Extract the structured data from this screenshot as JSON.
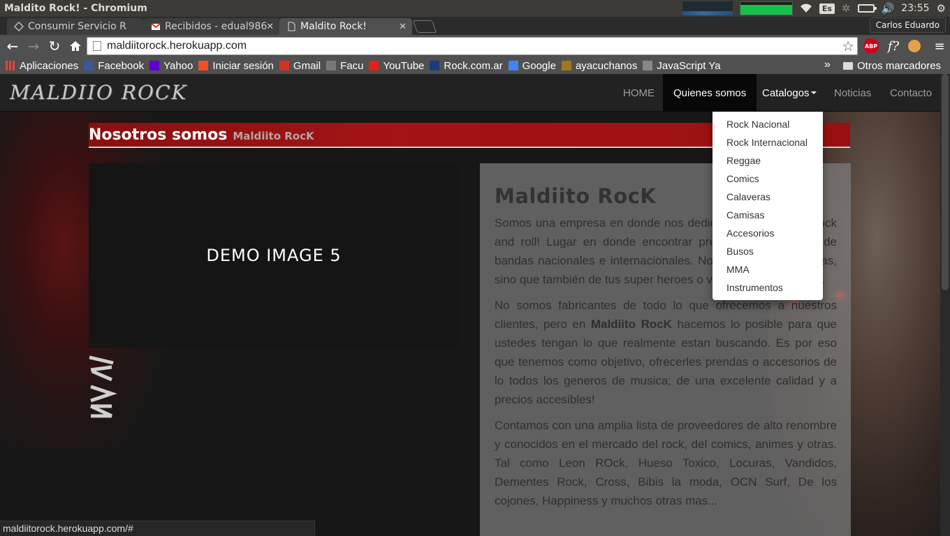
{
  "os": {
    "window_title": "Maldito Rock! - Chromium",
    "lang": "Es",
    "clock": "23:55"
  },
  "tabs": [
    {
      "label": "Consumir Servicio R",
      "icon": "servicio-icon"
    },
    {
      "label": "Recibidos - edual986",
      "icon": "gmail-icon"
    },
    {
      "label": "Maldito Rock!",
      "icon": "page-icon"
    }
  ],
  "profile_name": "Carlos Eduardo",
  "omnibox": {
    "url": "maldiitorock.herokuapp.com"
  },
  "bookmarks": {
    "items": [
      {
        "label": "Aplicaciones",
        "icon": "apps-grid-icon",
        "color": "#e8453c"
      },
      {
        "label": "Facebook",
        "icon": "facebook-icon",
        "color": "#3b5998"
      },
      {
        "label": "Yahoo",
        "icon": "yahoo-icon",
        "color": "#5f01d1"
      },
      {
        "label": "Iniciar sesión",
        "icon": "microsoft-icon",
        "color": "#f25022"
      },
      {
        "label": "Gmail",
        "icon": "gmail-icon",
        "color": "#d93025"
      },
      {
        "label": "Facu",
        "icon": "facu-icon",
        "color": "#777777"
      },
      {
        "label": "YouTube",
        "icon": "youtube-icon",
        "color": "#e62117"
      },
      {
        "label": "Rock.com.ar",
        "icon": "rock-icon",
        "color": "#1b3c7a"
      },
      {
        "label": "Google",
        "icon": "google-icon",
        "color": "#4285f4"
      },
      {
        "label": "ayacuchanos",
        "icon": "ayacuchanos-icon",
        "color": "#a07820"
      },
      {
        "label": "JavaScript Ya",
        "icon": "page-icon",
        "color": "#888888"
      }
    ],
    "more": "»",
    "other": "Otros marcadores"
  },
  "site": {
    "brand": "MALDIIO ROCK",
    "nav": {
      "home": "HOME",
      "quienes": "Quienes somos",
      "catalogos": "Catalogos",
      "noticias": "Noticias",
      "contacto": "Contacto"
    },
    "dropdown": [
      "Rock Nacional",
      "Rock Internacional",
      "Reggae",
      "Comics",
      "Calaveras",
      "Camisas",
      "Accesorios",
      "Busos",
      "MMA",
      "Instrumentos"
    ],
    "section_title": "Nosotros somos",
    "section_sub": "Maldiito RocK",
    "demo_image": "DEMO IMAGE 5",
    "panel": {
      "heading": "Maldiito RocK",
      "p1": "Somos una empresa en donde nos dedicamos al rubro del rock and roll! Lugar en donde encontrar prendas y accesorios de bandas nacionales e internacionales. No solamente de bandas, sino que también de tus super heroes o video juegos favoritos.",
      "p2_pre": "No somos fabricantes de todo lo que ofrecemos a nuestros clientes, pero en ",
      "p2_bold": "Maldiito RocK",
      "p2_post": " hacemos lo posible para que ustedes tengan lo que realmente estan buscando. Es por eso que tenemos como objetivo, ofrecerles prendas o accesorios de lo todos los generos de musica; de una excelente calidad y a precios accesibles!",
      "p3": "Contamos con una amplia lista de proveedores de alto renombre y conocidos en el mercado del rock, del comics, animes y otras. Tal como Leon ROck, Hueso Toxico, Locuras, Vandidos, Dementes Rock, Cross, Bibis la moda, OCN Surf, De los cojones, Happiness y muchos otras mas..."
    }
  },
  "status_url": "maldiitorock.herokuapp.com/#"
}
